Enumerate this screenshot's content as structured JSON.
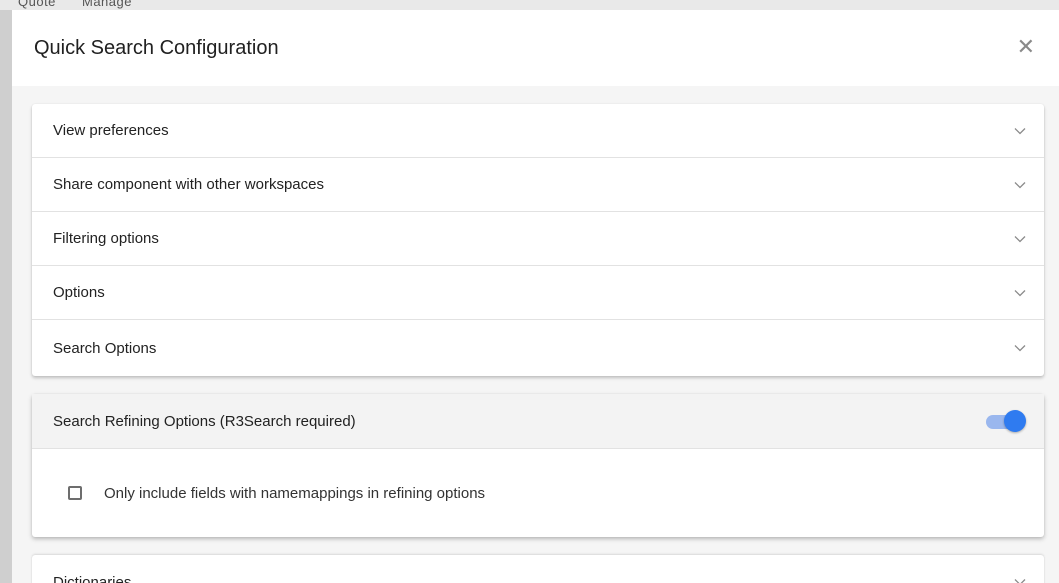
{
  "background": {
    "tabs": [
      "Quote",
      "Manage"
    ]
  },
  "dialog": {
    "title": "Quick Search Configuration",
    "close_icon": "close-icon"
  },
  "sections": [
    {
      "label": "View preferences",
      "icon": "chevron-down-icon"
    },
    {
      "label": "Share component with other workspaces",
      "icon": "chevron-down-icon"
    },
    {
      "label": "Filtering options",
      "icon": "chevron-down-icon"
    },
    {
      "label": "Options",
      "icon": "chevron-down-icon"
    },
    {
      "label": "Search Options",
      "icon": "chevron-down-icon"
    }
  ],
  "refining": {
    "label": "Search Refining Options (R3Search required)",
    "toggle_on": true,
    "checkbox_label": "Only include fields with namemappings in refining options",
    "checkbox_checked": false
  },
  "dictionaries": {
    "label": "Dictionaries"
  },
  "colors": {
    "toggle_accent": "#2f7bf0",
    "toggle_track": "#9ab7ee",
    "content_bg": "#f5f5f5"
  }
}
